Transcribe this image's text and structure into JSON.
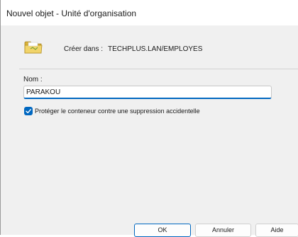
{
  "window": {
    "title": "Nouvel objet - Unité d'organisation"
  },
  "header": {
    "icon": "folder-icon",
    "create_label": "Créer dans :",
    "create_path": "TECHPLUS.LAN/EMPLOYES"
  },
  "form": {
    "name_label": "Nom :",
    "name_value": "PARAKOU",
    "protect_checked": true,
    "protect_label": "Protéger le conteneur contre une suppression accidentelle"
  },
  "buttons": {
    "ok": "OK",
    "cancel": "Annuler",
    "help": "Aide"
  },
  "colors": {
    "accent": "#0067c0",
    "folder": "#e9c84f"
  }
}
